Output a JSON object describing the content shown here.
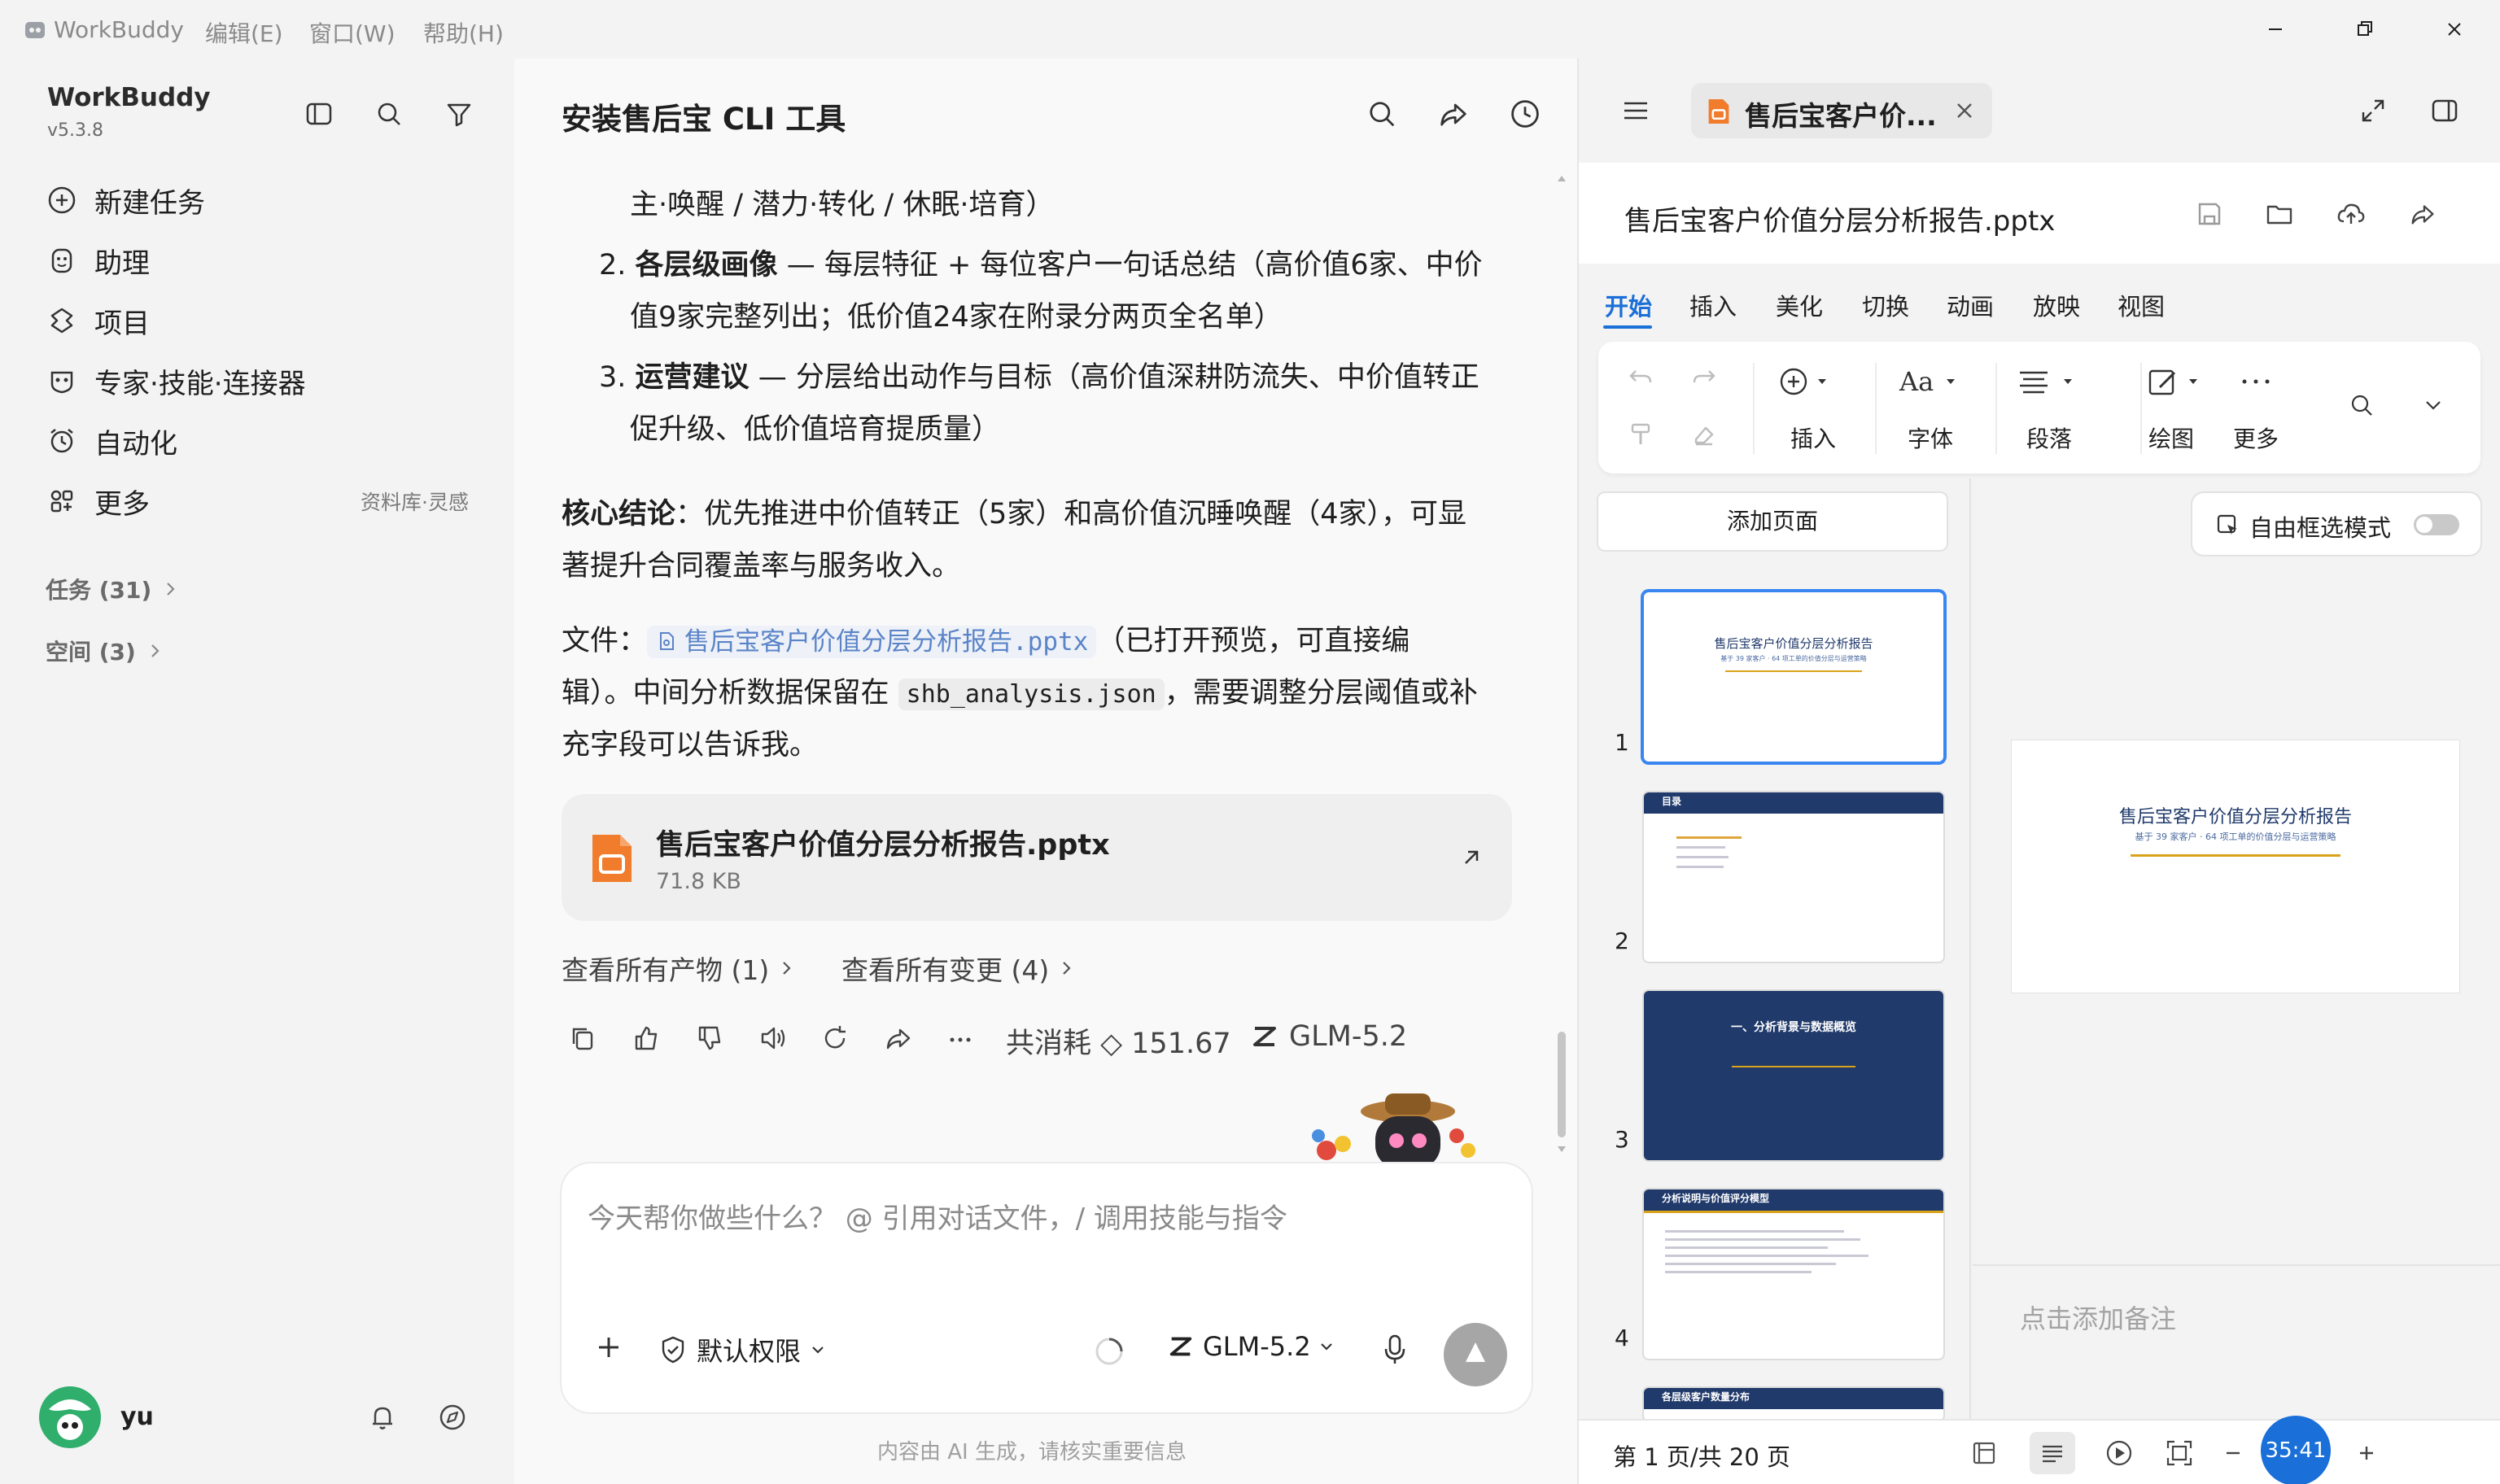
{
  "app": {
    "title": "WorkBuddy",
    "menus": [
      "编辑(E)",
      "窗口(W)",
      "帮助(H)"
    ],
    "version": "v5.3.8"
  },
  "sidebar": {
    "items": [
      {
        "label": "新建任务",
        "icon": "plus-circle-icon"
      },
      {
        "label": "助理",
        "icon": "assistant-icon"
      },
      {
        "label": "项目",
        "icon": "project-icon"
      },
      {
        "label": "专家·技能·连接器",
        "icon": "expert-icon"
      },
      {
        "label": "自动化",
        "icon": "alarm-icon"
      },
      {
        "label": "更多",
        "icon": "grid-icon"
      }
    ],
    "more_hint": "资料库·灵感",
    "tasks_label": "任务 (31)",
    "spaces_label": "空间 (3)",
    "user_name": "yu"
  },
  "chat": {
    "title": "安装售后宝 CLI 工具",
    "line0": "主·唤醒 / 潜力·转化 / 休眠·培育）",
    "item2_num": "2.",
    "item2_bold": "各层级画像",
    "item2_text": " — 每层特征 + 每位客户一句话总结（高价值6家、中价",
    "item2_line2": "值9家完整列出；低价值24家在附录分两页全名单）",
    "item3_num": "3.",
    "item3_bold": "运营建议",
    "item3_text": " — 分层给出动作与目标（高价值深耕防流失、中价值转正",
    "item3_line2": "促升级、低价值培育提质量）",
    "conclusion_bold": "核心结论",
    "conclusion_text": "：优先推进中价值转正（5家）和高价值沉睡唤醒（4家），可显",
    "conclusion_line2": "著提升合同覆盖率与服务收入。",
    "file_prefix": "文件：",
    "file_link": "售后宝客户价值分层分析报告.pptx",
    "file_after": "（已打开预览，可直接编",
    "file_line2_a": "辑）。中间分析数据保留在",
    "json_name": "shb_analysis.json",
    "file_line2_b": "，需要调整分层阈值或补",
    "file_line3": "充字段可以告诉我。",
    "card_name": "售后宝客户价值分层分析报告.pptx",
    "card_size": "71.8 KB",
    "view_outputs": "查看所有产物 (1)",
    "view_changes": "查看所有变更 (4)",
    "cost": "共消耗 ◇ 151.67",
    "model_used": "GLM-5.2",
    "input_placeholder": "今天帮你做些什么？ @ 引用对话文件，/ 调用技能与指令",
    "permission": "默认权限",
    "model_select": "GLM-5.2",
    "disclaimer": "内容由 AI 生成，请核实重要信息"
  },
  "right": {
    "tab_title": "售后宝客户价...",
    "doc_title": "售后宝客户价值分层分析报告.pptx",
    "ribbon_tabs": [
      "开始",
      "插入",
      "美化",
      "切换",
      "动画",
      "放映",
      "视图"
    ],
    "tools": [
      "插入",
      "字体",
      "段落",
      "绘图",
      "更多"
    ],
    "add_page": "添加页面",
    "free_select": "自由框选模式",
    "slide1_title": "售后宝客户价值分层分析报告",
    "slide1_sub": "基于 39 家客户 · 64 项工单的价值分层与运营策略",
    "slide2_title": "目录",
    "slide3_title": "一、分析背景与数据概览",
    "slide4_title": "分析说明与价值评分模型",
    "slide5_title": "各层级客户数量分布",
    "notes_placeholder": "点击添加备注",
    "page_indicator": "第 1 页/共 20 页",
    "timer": "35:41"
  },
  "colors": {
    "accent": "#1a6fd8",
    "slide_dark": "#203a6b",
    "file_orange": "#f07c2c",
    "gold": "#d9a21b"
  }
}
